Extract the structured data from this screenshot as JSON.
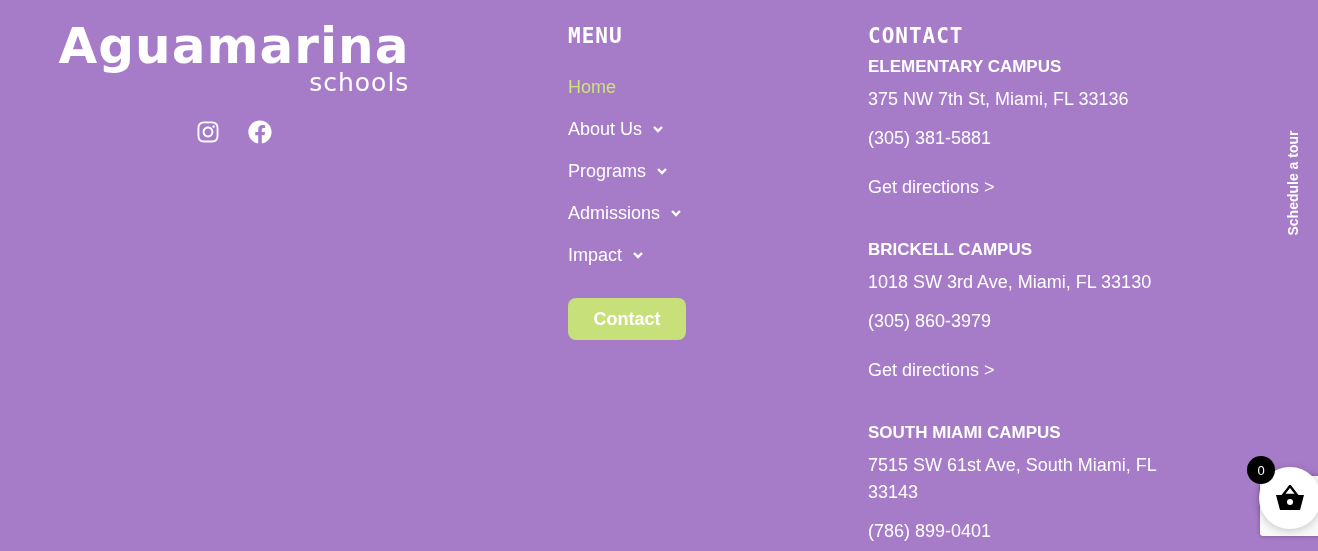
{
  "logo": {
    "name": "Aguamarina",
    "tagline": "schools"
  },
  "social": [
    {
      "kind": "instagram"
    },
    {
      "kind": "facebook"
    }
  ],
  "menu": {
    "title": "MENU",
    "items": [
      {
        "label": "Home",
        "selected": true,
        "has_submenu": false
      },
      {
        "label": "About Us",
        "selected": false,
        "has_submenu": true
      },
      {
        "label": "Programs",
        "selected": false,
        "has_submenu": true
      },
      {
        "label": "Admissions",
        "selected": false,
        "has_submenu": true
      },
      {
        "label": "Impact",
        "selected": false,
        "has_submenu": true
      }
    ],
    "button": "Contact"
  },
  "contact": {
    "title": "CONTACT",
    "campuses": [
      {
        "name": "ELEMENTARY CAMPUS",
        "lines": [
          {
            "kind": "address",
            "text": "375 NW 7th St, Miami, FL 33136"
          },
          {
            "kind": "phone",
            "text": "(305) 381-5881"
          },
          {
            "kind": "link",
            "text": "Get directions >"
          }
        ]
      },
      {
        "name": "BRICKELL CAMPUS",
        "lines": [
          {
            "kind": "address",
            "text": "1018 SW 3rd Ave, Miami, FL 33130"
          },
          {
            "kind": "phone",
            "text": "(305) 860-3979"
          },
          {
            "kind": "link",
            "text": "Get directions >"
          }
        ]
      },
      {
        "name": "SOUTH MIAMI CAMPUS",
        "lines": [
          {
            "kind": "address",
            "text": "7515 SW 61st Ave, South Miami, FL 33143"
          },
          {
            "kind": "phone",
            "text": "(786) 899-0401"
          }
        ]
      }
    ]
  },
  "side_tab": "Schedule a tour",
  "cart": {
    "count": "0"
  }
}
